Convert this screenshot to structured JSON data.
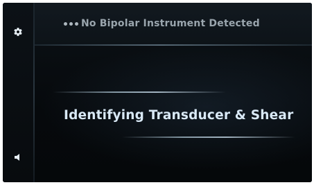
{
  "status": {
    "indicator": "•••",
    "text": "No Bipolar Instrument Detected"
  },
  "main": {
    "message": "Identifying Transducer & Shear"
  },
  "sidebar": {
    "icons": [
      "gear-icon",
      "speaker-icon"
    ]
  },
  "colors": {
    "background": "#070a0d",
    "status_text": "#9aa5ad",
    "message_text": "#d9e9f6"
  }
}
